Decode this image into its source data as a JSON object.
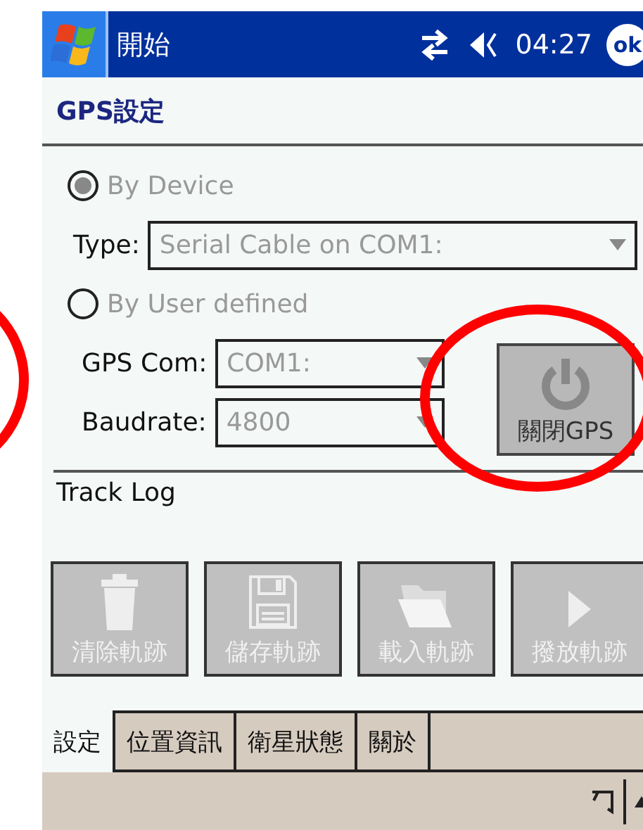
{
  "title_bar": {
    "start_label": "開始",
    "time": "04:27",
    "ok_label": "ok"
  },
  "header": {
    "title": "GPS設定"
  },
  "source": {
    "options": [
      {
        "label": "By Device",
        "selected": true,
        "disabled": true
      },
      {
        "label": "By User defined",
        "selected": false,
        "disabled": true
      }
    ],
    "type_field": {
      "label": "Type:",
      "value": "Serial Cable on COM1:",
      "disabled": true
    },
    "gps_com_field": {
      "label": "GPS Com:",
      "value": "COM1:",
      "disabled": true
    },
    "baudrate_field": {
      "label": "Baudrate:",
      "value": "4800",
      "disabled": true
    },
    "gps_button": {
      "label": "關閉GPS",
      "disabled": true
    }
  },
  "track_log": {
    "title": "Track Log",
    "buttons": [
      {
        "kind": "clear",
        "label": "清除軌跡",
        "disabled": true
      },
      {
        "kind": "save",
        "label": "儲存軌跡",
        "disabled": true
      },
      {
        "kind": "load",
        "label": "載入軌跡",
        "disabled": true
      },
      {
        "kind": "play",
        "label": "撥放軌跡",
        "disabled": true
      }
    ]
  },
  "tabs": [
    {
      "label": "設定",
      "selected": true
    },
    {
      "label": "位置資訊",
      "selected": false
    },
    {
      "label": "衛星狀態",
      "selected": false
    },
    {
      "label": "關於",
      "selected": false
    }
  ]
}
